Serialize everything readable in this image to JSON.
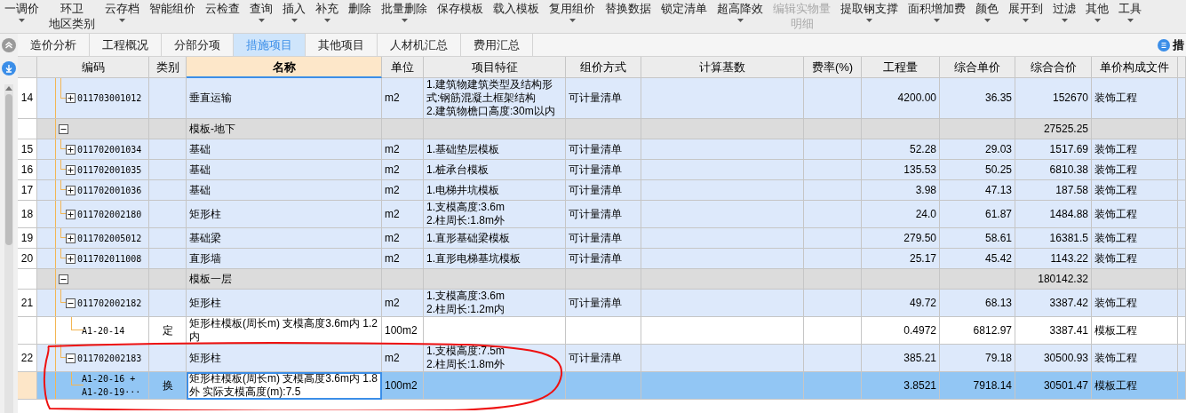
{
  "toolbar": [
    {
      "label": "一调价",
      "dropdown": true,
      "disabled": false
    },
    {
      "label": "环卫",
      "sublabel": "地区类别",
      "dropdown": false,
      "disabled": false
    },
    {
      "label": "云存档",
      "dropdown": true,
      "disabled": false
    },
    {
      "label": "智能组价",
      "dropdown": false,
      "disabled": false
    },
    {
      "label": "云检查",
      "dropdown": false,
      "disabled": false
    },
    {
      "label": "查询",
      "dropdown": true,
      "disabled": false
    },
    {
      "label": "插入",
      "dropdown": true,
      "disabled": false
    },
    {
      "label": "补充",
      "dropdown": true,
      "disabled": false
    },
    {
      "label": "删除",
      "dropdown": false,
      "disabled": false
    },
    {
      "label": "批量删除",
      "dropdown": true,
      "disabled": false
    },
    {
      "label": "保存模板",
      "dropdown": false,
      "disabled": false
    },
    {
      "label": "载入模板",
      "dropdown": false,
      "disabled": false
    },
    {
      "label": "复用组价",
      "dropdown": true,
      "disabled": false
    },
    {
      "label": "替换数据",
      "dropdown": false,
      "disabled": false
    },
    {
      "label": "锁定清单",
      "dropdown": false,
      "disabled": false
    },
    {
      "label": "超高降效",
      "dropdown": true,
      "disabled": false
    },
    {
      "label": "编辑实物量",
      "sublabel": "明细",
      "dropdown": false,
      "disabled": true
    },
    {
      "label": "提取钢支撑",
      "dropdown": true,
      "disabled": false
    },
    {
      "label": "面积增加费",
      "dropdown": true,
      "disabled": false
    },
    {
      "label": "颜色",
      "dropdown": true,
      "disabled": false
    },
    {
      "label": "展开到",
      "dropdown": true,
      "disabled": false
    },
    {
      "label": "过滤",
      "dropdown": true,
      "disabled": false
    },
    {
      "label": "其他",
      "dropdown": true,
      "disabled": false
    },
    {
      "label": "工具",
      "dropdown": true,
      "disabled": false
    }
  ],
  "tabs": [
    {
      "label": "造价分析",
      "selected": false
    },
    {
      "label": "工程概况",
      "selected": false
    },
    {
      "label": "分部分项",
      "selected": false
    },
    {
      "label": "措施项目",
      "selected": true
    },
    {
      "label": "其他项目",
      "selected": false
    },
    {
      "label": "人材机汇总",
      "selected": false
    },
    {
      "label": "费用汇总",
      "selected": false
    }
  ],
  "tab_bar_right": {
    "label": "措"
  },
  "table": {
    "columns": [
      {
        "label": "编码",
        "selected": false
      },
      {
        "label": "类别",
        "selected": false
      },
      {
        "label": "名称",
        "selected": true
      },
      {
        "label": "单位",
        "selected": false
      },
      {
        "label": "项目特征",
        "selected": false
      },
      {
        "label": "组价方式",
        "selected": false
      },
      {
        "label": "计算基数",
        "selected": false
      },
      {
        "label": "费率(%)",
        "selected": false
      },
      {
        "label": "工程量",
        "selected": false
      },
      {
        "label": "综合单价",
        "selected": false
      },
      {
        "label": "综合合价",
        "selected": false
      },
      {
        "label": "单价构成文件",
        "selected": false
      }
    ],
    "rows": [
      {
        "kind": "bill",
        "num": "14",
        "code": "011703001012",
        "name": "垂直运输",
        "unit": "m2",
        "features": [
          "1.建筑物建筑类型及结构形式:钢筋混凝土框架结构",
          "2.建筑物檐口高度:30m以内"
        ],
        "method": "可计量清单",
        "qty": "4200.00",
        "unit_price": "36.35",
        "total": "152670",
        "file": "装饰工程",
        "expanded": false,
        "selected": false
      },
      {
        "kind": "group",
        "name": "模板-地下",
        "total": "27525.25",
        "expanded": true,
        "selected": false,
        "children": [
          {
            "kind": "bill",
            "num": "15",
            "code": "011702001034",
            "name": "基础",
            "unit": "m2",
            "features": [
              "1.基础垫层模板"
            ],
            "method": "可计量清单",
            "qty": "52.28",
            "unit_price": "29.03",
            "total": "1517.69",
            "file": "装饰工程",
            "expanded": false,
            "selected": false
          },
          {
            "kind": "bill",
            "num": "16",
            "code": "011702001035",
            "name": "基础",
            "unit": "m2",
            "features": [
              "1.桩承台模板"
            ],
            "method": "可计量清单",
            "qty": "135.53",
            "unit_price": "50.25",
            "total": "6810.38",
            "file": "装饰工程",
            "expanded": false,
            "selected": false
          },
          {
            "kind": "bill",
            "num": "17",
            "code": "011702001036",
            "name": "基础",
            "unit": "m2",
            "features": [
              "1.电梯井坑模板"
            ],
            "method": "可计量清单",
            "qty": "3.98",
            "unit_price": "47.13",
            "total": "187.58",
            "file": "装饰工程",
            "expanded": false,
            "selected": false
          },
          {
            "kind": "bill",
            "num": "18",
            "code": "011702002180",
            "name": "矩形柱",
            "unit": "m2",
            "features": [
              "1.支模高度:3.6m",
              "2.柱周长:1.8m外"
            ],
            "method": "可计量清单",
            "qty": "24.0",
            "unit_price": "61.87",
            "total": "1484.88",
            "file": "装饰工程",
            "expanded": false,
            "selected": false
          },
          {
            "kind": "bill",
            "num": "19",
            "code": "011702005012",
            "name": "基础梁",
            "unit": "m2",
            "features": [
              "1.直形基础梁模板"
            ],
            "method": "可计量清单",
            "qty": "279.50",
            "unit_price": "58.61",
            "total": "16381.5",
            "file": "装饰工程",
            "expanded": false,
            "selected": false
          },
          {
            "kind": "bill",
            "num": "20",
            "code": "011702011008",
            "name": "直形墙",
            "unit": "m2",
            "features": [
              "1.直形电梯基坑模板"
            ],
            "method": "可计量清单",
            "qty": "25.17",
            "unit_price": "45.42",
            "total": "1143.22",
            "file": "装饰工程",
            "expanded": false,
            "selected": false
          }
        ]
      },
      {
        "kind": "group",
        "name": "模板一层",
        "total": "180142.32",
        "expanded": true,
        "selected": false,
        "children": [
          {
            "kind": "bill",
            "num": "21",
            "code": "011702002182",
            "name": "矩形柱",
            "unit": "m2",
            "features": [
              "1.支模高度:3.6m",
              "2.柱周长:1.2m内"
            ],
            "method": "可计量清单",
            "qty": "49.72",
            "unit_price": "68.13",
            "total": "3387.42",
            "file": "装饰工程",
            "expanded": true,
            "selected": false,
            "children": [
              {
                "kind": "quota",
                "code": "A1-20-14",
                "type": "定",
                "name": "矩形柱模板(周长m) 支模高度3.6m内 1.2内",
                "unit": "100m2",
                "qty": "0.4972",
                "unit_price": "6812.97",
                "total": "3387.41",
                "file": "模板工程",
                "selected": false
              }
            ]
          },
          {
            "kind": "bill",
            "num": "22",
            "code": "011702002183",
            "name": "矩形柱",
            "unit": "m2",
            "features": [
              "1.支模高度:7.5m",
              "2.柱周长:1.8m外"
            ],
            "method": "可计量清单",
            "qty": "385.21",
            "unit_price": "79.18",
            "total": "30500.93",
            "file": "装饰工程",
            "expanded": true,
            "selected": false,
            "children": [
              {
                "kind": "quota",
                "code": "A1-20-16 + A1-20-19···",
                "type": "换",
                "name": "矩形柱模板(周长m) 支模高度3.6m内 1.8外  实际支模高度(m):7.5",
                "unit": "100m2",
                "qty": "3.8521",
                "unit_price": "7918.14",
                "total": "30501.47",
                "file": "模板工程",
                "selected": true
              }
            ]
          }
        ]
      }
    ]
  }
}
